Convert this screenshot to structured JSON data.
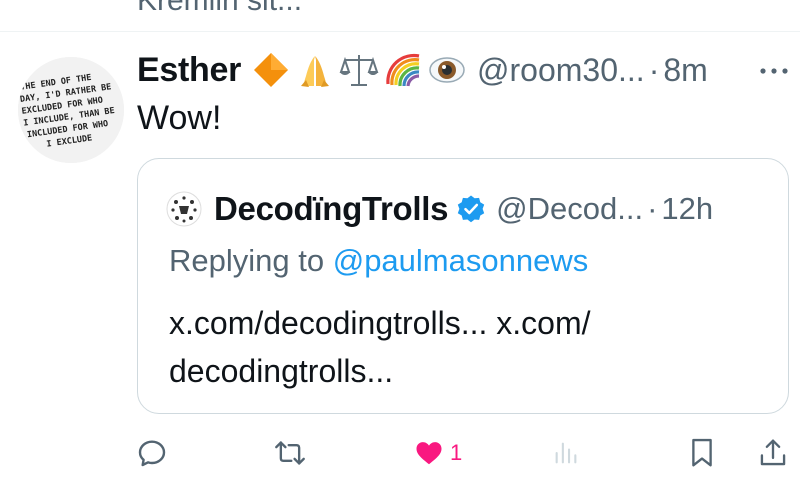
{
  "previous_tweet": {
    "text_fragment": "Kremlin sit..."
  },
  "tweet": {
    "author_name": "Esther",
    "emoji_names": [
      "orange-diamond-icon",
      "folded-hands-icon",
      "balance-scale-icon",
      "rainbow-icon",
      "eye-icon"
    ],
    "handle": "@room30...",
    "separator": "·",
    "time": "8m",
    "text": "Wow!",
    "avatar_lines": [
      "THE END OF THE",
      "DAY, I'D RATHER BE",
      "EXCLUDED FOR WHO",
      "I INCLUDE, THAN BE",
      "INCLUDED FOR WHO",
      "I EXCLUDE"
    ]
  },
  "quote": {
    "author_name": "DecodïngTrolls",
    "handle": "@Decod...",
    "separator": "·",
    "time": "12h",
    "replying_prefix": "Replying to",
    "replying_mention": "@paulmasonnews",
    "text_line1": "x.com/decodingtrolls... x.com/",
    "text_line2": "decodingtrolls..."
  },
  "actions": {
    "like_count": "1",
    "colors": {
      "like": "#f91880",
      "muted": "#536471",
      "link": "#1d9bf0",
      "verified": "#1d9bf0"
    }
  }
}
